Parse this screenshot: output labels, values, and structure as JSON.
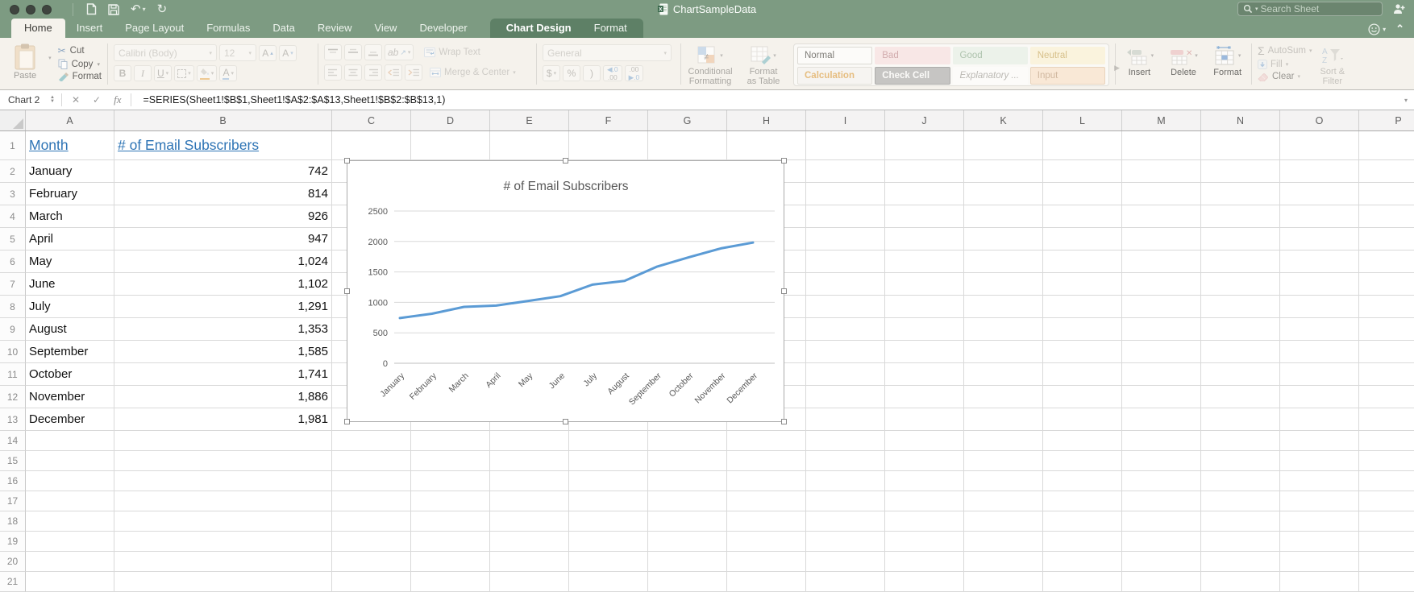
{
  "colors": {
    "theme_green": "#7d9b82",
    "contextual_green": "#5e8066",
    "link_blue": "#2e74b5",
    "chart_line": "#5b9bd5",
    "chart_text": "#595959",
    "gridline": "#d9d9d9"
  },
  "titlebar": {
    "title": "ChartSampleData",
    "search_placeholder": "Search Sheet"
  },
  "icons": {
    "undo": "↶",
    "redo": "↻",
    "caret_down": "▾",
    "chevron_up": "⌃",
    "close": "✕",
    "check": "✓",
    "fx": "fx",
    "spinner_up": "▲",
    "spinner_down": "▼",
    "gallery_more": "▶",
    "sigma": "Σ",
    "tri_up": "▴",
    "tri_down": "▾",
    "orient_ab": "ab",
    "orient_arrow": "↗"
  },
  "tabs": {
    "main": [
      "Home",
      "Insert",
      "Page Layout",
      "Formulas",
      "Data",
      "Review",
      "View",
      "Developer"
    ],
    "active": "Home",
    "contextual": [
      "Chart Design",
      "Format"
    ],
    "contextual_active": "Chart Design"
  },
  "ribbon": {
    "paste": "Paste",
    "cut": "Cut",
    "copy": "Copy",
    "format_painter": "Format",
    "font_name": "Calibri (Body)",
    "font_size": "12",
    "grow_font": "A",
    "shrink_font": "A",
    "bold": "B",
    "italic": "I",
    "underline": "U",
    "wrap_text": "Wrap Text",
    "merge_center": "Merge & Center",
    "number_format": "General",
    "currency": "$",
    "percent": "%",
    "comma": ")",
    "inc_dec_top": "◀.0",
    "inc_dec_bottom": ".00",
    "dec_dec_top": ".00",
    "dec_dec_bottom": "▶.0",
    "conditional_formatting": [
      "Conditional",
      "Formatting"
    ],
    "format_as_table": [
      "Format",
      "as Table"
    ],
    "styles": [
      {
        "label": "Normal",
        "fg": "#4d4b47",
        "bg": "#ffffff",
        "border": "#d2d0cb",
        "style": "normal"
      },
      {
        "label": "Bad",
        "fg": "#c48f94",
        "bg": "#fae3e4",
        "border": "transparent",
        "style": "normal"
      },
      {
        "label": "Good",
        "fg": "#8fae92",
        "bg": "#e9f3ea",
        "border": "transparent",
        "style": "normal"
      },
      {
        "label": "Neutral",
        "fg": "#cbac62",
        "bg": "#fdf4d7",
        "border": "transparent",
        "style": "normal"
      },
      {
        "label": "Calculation",
        "fg": "#e0a752",
        "bg": "#f7f6f4",
        "border": "#dcdad5",
        "style": "bold"
      },
      {
        "label": "Check Cell",
        "fg": "#ffffff",
        "bg": "#b3b3b3",
        "border": "#8f8f8f",
        "style": "bold"
      },
      {
        "label": "Explanatory ...",
        "fg": "#a3a19c",
        "bg": "#ffffff",
        "border": "transparent",
        "style": "italic"
      },
      {
        "label": "Input",
        "fg": "#c2a080",
        "bg": "#fbe5cd",
        "border": "#e3c6a8",
        "style": "normal"
      }
    ],
    "insert": "Insert",
    "delete": "Delete",
    "format_cells": "Format",
    "autosum": "AutoSum",
    "fill": "Fill",
    "clear": "Clear",
    "sort_filter": [
      "Sort &",
      "Filter"
    ]
  },
  "formula_bar": {
    "name_box": "Chart 2",
    "formula": "=SERIES(Sheet1!$B$1,Sheet1!$A$2:$A$13,Sheet1!$B$2:$B$13,1)"
  },
  "grid": {
    "columns": [
      "A",
      "B",
      "C",
      "D",
      "E",
      "F",
      "G",
      "H",
      "I",
      "J",
      "K",
      "L",
      "M",
      "N",
      "O",
      "P"
    ],
    "visible_rows": 21,
    "header_a": "Month",
    "header_b": "# of Email Subscribers",
    "rows": [
      {
        "month": "January",
        "value": "742"
      },
      {
        "month": "February",
        "value": "814"
      },
      {
        "month": "March",
        "value": "926"
      },
      {
        "month": "April",
        "value": "947"
      },
      {
        "month": "May",
        "value": "1,024"
      },
      {
        "month": "June",
        "value": "1,102"
      },
      {
        "month": "July",
        "value": "1,291"
      },
      {
        "month": "August",
        "value": "1,353"
      },
      {
        "month": "September",
        "value": "1,585"
      },
      {
        "month": "October",
        "value": "1,741"
      },
      {
        "month": "November",
        "value": "1,886"
      },
      {
        "month": "December",
        "value": "1,981"
      }
    ]
  },
  "chart_data": {
    "type": "line",
    "title": "# of Email Subscribers",
    "categories": [
      "January",
      "February",
      "March",
      "April",
      "May",
      "June",
      "July",
      "August",
      "September",
      "October",
      "November",
      "December"
    ],
    "values": [
      742,
      814,
      926,
      947,
      1024,
      1102,
      1291,
      1353,
      1585,
      1741,
      1886,
      1981
    ],
    "ylim": [
      0,
      2500
    ],
    "ytick_step": 500,
    "grid": true,
    "legend": "none",
    "line_color": "#5b9bd5",
    "selected": true
  }
}
